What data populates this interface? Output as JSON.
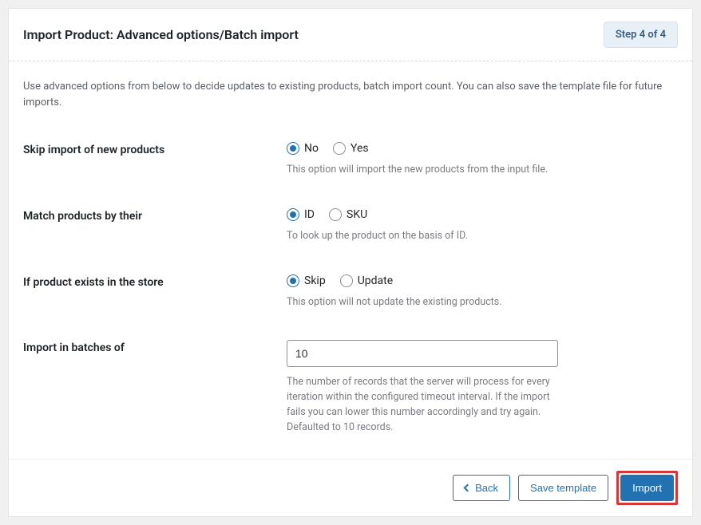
{
  "header": {
    "title": "Import Product: Advanced options/Batch import",
    "step_badge": "Step 4 of 4"
  },
  "intro": "Use advanced options from below to decide updates to existing products, batch import count. You can also save the template file for future imports.",
  "fields": {
    "skip_new": {
      "label": "Skip import of new products",
      "opt_no": "No",
      "opt_yes": "Yes",
      "help": "This option will import the new products from the input file."
    },
    "match_by": {
      "label": "Match products by their",
      "opt_id": "ID",
      "opt_sku": "SKU",
      "help": "To look up the product on the basis of ID."
    },
    "if_exists": {
      "label": "If product exists in the store",
      "opt_skip": "Skip",
      "opt_update": "Update",
      "help": "This option will not update the existing products."
    },
    "batch": {
      "label": "Import in batches of",
      "value": "10",
      "help": "The number of records that the server will process for every iteration within the configured timeout interval. If the import fails you can lower this number accordingly and try again. Defaulted to 10 records."
    }
  },
  "footer": {
    "back": "Back",
    "save_template": "Save template",
    "import": "Import"
  }
}
